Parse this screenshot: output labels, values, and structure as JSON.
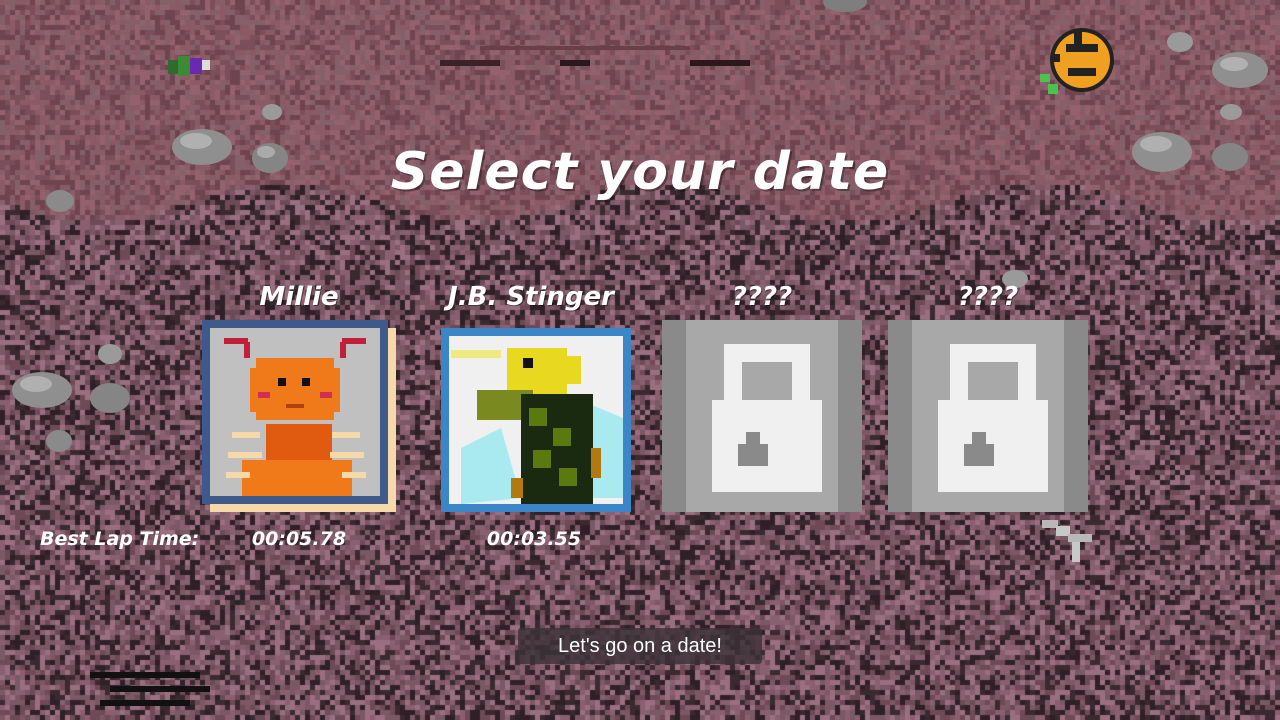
{
  "title": "Select your date",
  "characters": [
    {
      "name": "Millie",
      "locked": false,
      "selected": true,
      "best_lap": "00:05.78",
      "icon": "ant-portrait"
    },
    {
      "name": "J.B. Stinger",
      "locked": false,
      "selected": false,
      "best_lap": "00:03.55",
      "icon": "bee-portrait"
    },
    {
      "name": "????",
      "locked": true,
      "selected": false,
      "best_lap": "",
      "icon": "lock-icon"
    },
    {
      "name": "????",
      "locked": true,
      "selected": false,
      "best_lap": "",
      "icon": "lock-icon"
    }
  ],
  "best_lap_label": "Best Lap Time:",
  "start_button": "Let's go on a date!",
  "colors": {
    "dirt_light": "#8a5a66",
    "dirt_dark": "#3a2a30",
    "selected_frame": "#3d5a8a",
    "bee_frame": "#3a86c8",
    "locked_card": "#a8a8a8"
  }
}
